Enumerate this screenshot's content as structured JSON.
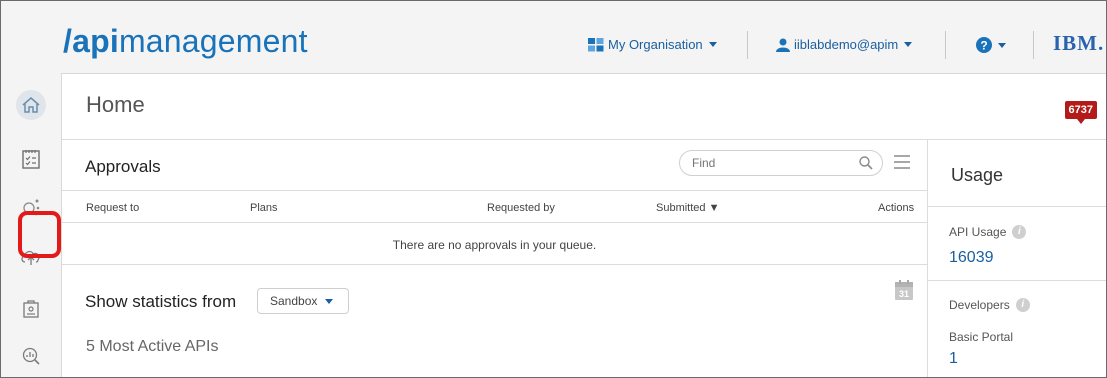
{
  "header": {
    "logo_slash": "/",
    "logo_api": "api",
    "logo_rest": "management",
    "organisation_label": "My Organisation",
    "user_label": "iiblabdemo@apim",
    "brand": "IBM."
  },
  "sidebar": {
    "items": [
      "home-icon",
      "approvals-icon",
      "analytics-icon",
      "cloud-icon",
      "developer-icon",
      "search-analytics-icon"
    ]
  },
  "main": {
    "title": "Home",
    "notification_count": "6737",
    "approvals": {
      "title": "Approvals",
      "find_placeholder": "Find",
      "columns": [
        "Request to",
        "Plans",
        "Requested by",
        "Submitted ▼",
        "Actions"
      ],
      "empty_message": "There are no approvals in your queue."
    },
    "statistics": {
      "label": "Show statistics from",
      "environment": "Sandbox",
      "calendar_day": "31",
      "section_title": "5 Most Active APIs"
    }
  },
  "usage": {
    "title": "Usage",
    "api_usage_label": "API Usage",
    "api_usage_value": "16039",
    "developers_label": "Developers",
    "portal_label": "Basic Portal",
    "portal_value": "1"
  },
  "colors": {
    "accent": "#1a73b8",
    "link": "#1a5fa0",
    "badge": "#b31b1b",
    "highlight": "#e21a1a"
  }
}
